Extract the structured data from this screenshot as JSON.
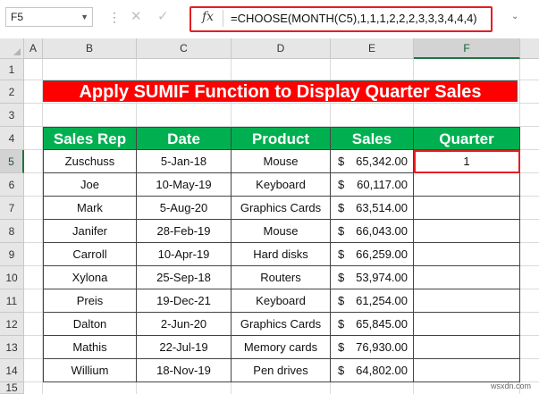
{
  "formula_bar": {
    "name_box": "F5",
    "fx_label": "fx",
    "formula": "=CHOOSE(MONTH(C5),1,1,1,2,2,2,3,3,3,4,4,4)"
  },
  "columns": [
    "A",
    "B",
    "C",
    "D",
    "E",
    "F"
  ],
  "rows": [
    "1",
    "2",
    "3",
    "4",
    "5",
    "6",
    "7",
    "8",
    "9",
    "10",
    "11",
    "12",
    "13",
    "14",
    "15"
  ],
  "sheet": {
    "title": "Apply SUMIF Function to Display Quarter Sales",
    "headers": [
      "Sales Rep",
      "Date",
      "Product",
      "Sales",
      "Quarter"
    ],
    "currency_symbol": "$",
    "records": [
      {
        "rep": "Zuschuss",
        "date": "5-Jan-18",
        "product": "Mouse",
        "sales": "65,342.00",
        "quarter": "1"
      },
      {
        "rep": "Joe",
        "date": "10-May-19",
        "product": "Keyboard",
        "sales": "60,117.00",
        "quarter": ""
      },
      {
        "rep": "Mark",
        "date": "5-Aug-20",
        "product": "Graphics Cards",
        "sales": "63,514.00",
        "quarter": ""
      },
      {
        "rep": "Janifer",
        "date": "28-Feb-19",
        "product": "Mouse",
        "sales": "66,043.00",
        "quarter": ""
      },
      {
        "rep": "Carroll",
        "date": "10-Apr-19",
        "product": "Hard disks",
        "sales": "66,259.00",
        "quarter": ""
      },
      {
        "rep": "Xylona",
        "date": "25-Sep-18",
        "product": "Routers",
        "sales": "53,974.00",
        "quarter": ""
      },
      {
        "rep": "Preis",
        "date": "19-Dec-21",
        "product": "Keyboard",
        "sales": "61,254.00",
        "quarter": ""
      },
      {
        "rep": "Dalton",
        "date": "2-Jun-20",
        "product": "Graphics Cards",
        "sales": "65,845.00",
        "quarter": ""
      },
      {
        "rep": "Mathis",
        "date": "22-Jul-19",
        "product": "Memory cards",
        "sales": "76,930.00",
        "quarter": ""
      },
      {
        "rep": "Willium",
        "date": "18-Nov-19",
        "product": "Pen drives",
        "sales": "64,802.00",
        "quarter": ""
      }
    ]
  },
  "watermark": "wsxdn.com",
  "colors": {
    "title_bg": "#ff0000",
    "header_bg": "#00b050",
    "highlight": "#e31e24",
    "selection": "#217346"
  }
}
